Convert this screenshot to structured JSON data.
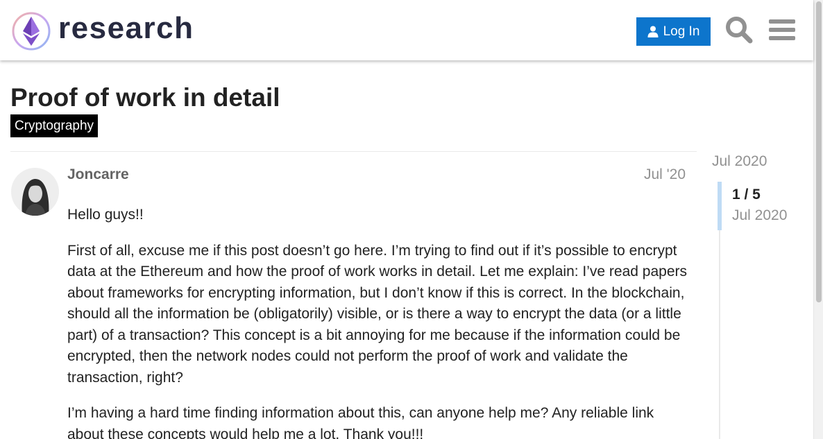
{
  "header": {
    "logo_text": "research",
    "login_label": "Log In",
    "icons": [
      "ethereum-logo-icon",
      "user-icon",
      "search-icon",
      "hamburger-menu-icon"
    ]
  },
  "topic": {
    "title": "Proof of work in detail",
    "category": "Cryptography"
  },
  "post": {
    "author": "Joncarre",
    "date": "Jul '20",
    "paragraphs": [
      "Hello guys!!",
      "First of all, excuse me if this post doesn’t go here. I’m trying to find out if it’s possible to encrypt data at the Ethereum and how the proof of work works in detail. Let me explain: I’ve read papers about frameworks for encrypting information, but I don’t know if this is correct. In the blockchain, should all the information be (obligatorily) visible, or is there a way to encrypt the data (or a little part) of a transaction? This concept is a bit annoying for me because if the information could be encrypted, then the network nodes could not perform the proof of work and validate the transaction, right?",
      "I’m having a hard time finding information about this, can anyone help me? Any reliable link about these concepts would help me a lot. Thank you!!!"
    ]
  },
  "timeline": {
    "start_date": "Jul 2020",
    "progress": "1 / 5",
    "current_date": "Jul 2020",
    "progress_fraction": 0.2
  },
  "colors": {
    "accent": "#0d75cc",
    "category_bg": "#000000",
    "timeline_handle": "#bfdbf5",
    "muted_text": "#919191"
  }
}
